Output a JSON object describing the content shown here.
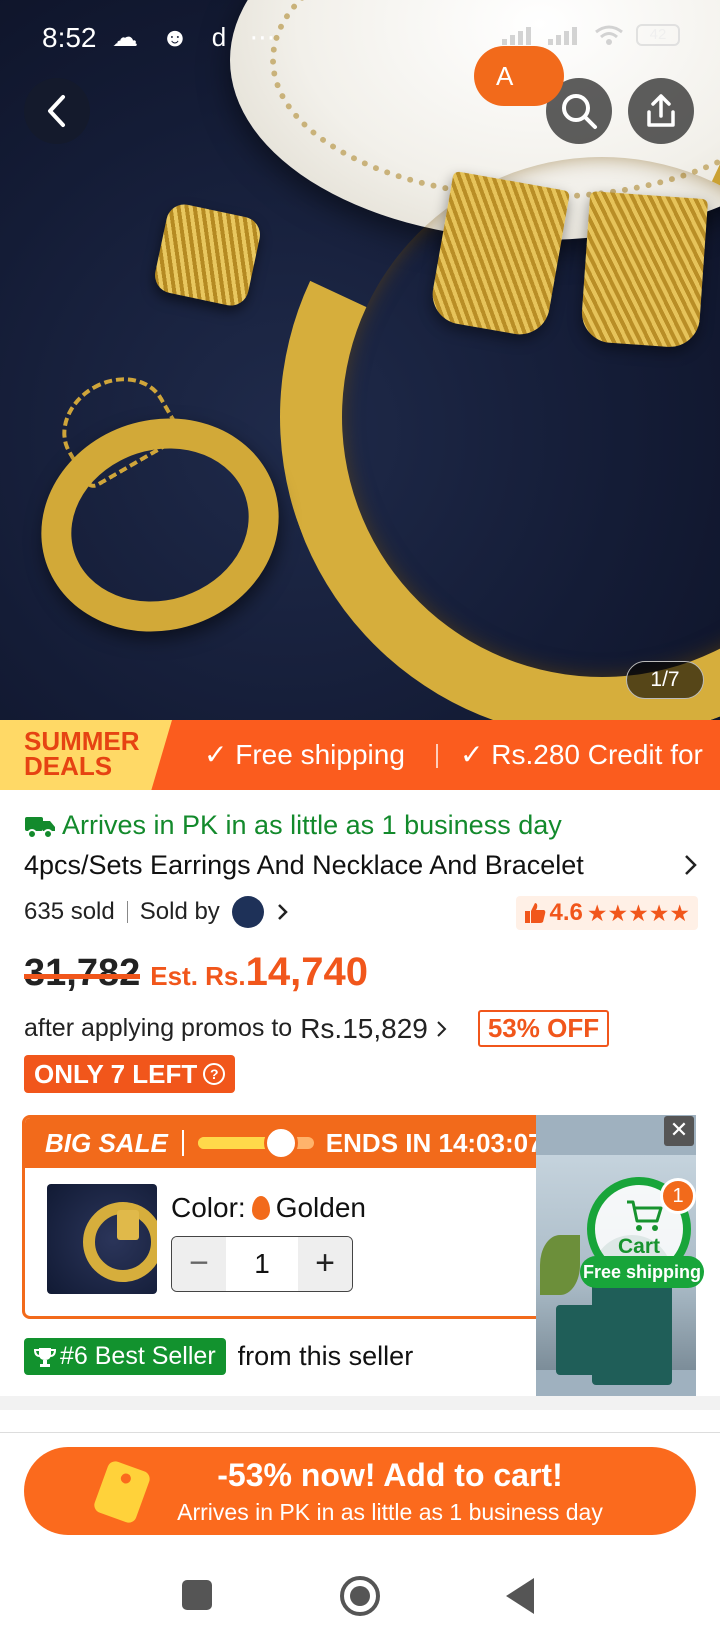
{
  "status_bar": {
    "time": "8:52",
    "left_icons": "☁ ☻ d ⋯",
    "battery": "42"
  },
  "gallery": {
    "counter": "1/7"
  },
  "banner": {
    "badge_line1": "SUMMER",
    "badge_line2": "DEALS",
    "feature1": "✓ Free shipping",
    "feature2": "✓ Rs.280 Credit for"
  },
  "product": {
    "arrival": "Arrives in PK in as little as 1 business day",
    "title": "4pcs/Sets Earrings And Necklace And Bracelet",
    "sold": "635 sold",
    "sold_by": "Sold by",
    "rating": "4.6",
    "stars": "★★★★★"
  },
  "price": {
    "original": "31,782",
    "est_prefix": "Est. Rs.",
    "est_value": "14,740",
    "promo_text": "after applying promos to",
    "promo_amount": "Rs.15,829",
    "off_badge": "53% OFF",
    "stock_badge": "ONLY 7 LEFT"
  },
  "sale": {
    "label": "BIG SALE",
    "ends": "ENDS IN  14:03:07",
    "progress": 0.72,
    "color_label": "Color:",
    "color_value": "Golden",
    "minus": "−",
    "quantity": "1",
    "plus": "+",
    "add_label": "A"
  },
  "float_cart": {
    "close": "✕",
    "count": "1",
    "cart_label": "Cart",
    "free_shipping": "Free shipping"
  },
  "best_seller": {
    "tag": "#6 Best Seller",
    "suffix": "from this seller"
  },
  "cta": {
    "line1": "-53% now! Add to cart!",
    "line2": "Arrives in PK in as little as 1 business day"
  },
  "colors": {
    "accent": "#fb5c1e",
    "green": "#138a2c",
    "sale_orange": "#f26a1b"
  }
}
